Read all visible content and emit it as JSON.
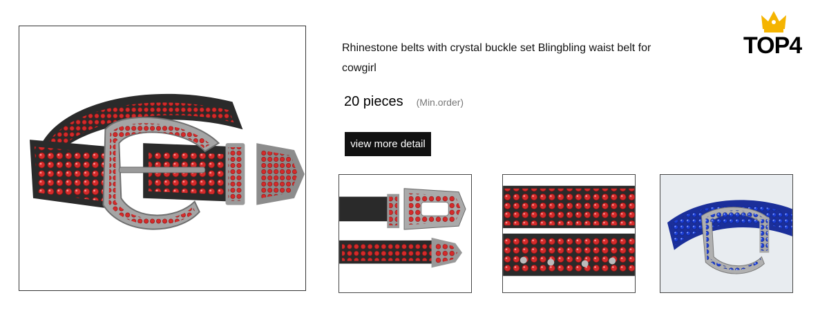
{
  "product": {
    "title": "Rhinestone belts with crystal buckle set Blingbling waist belt for cowgirl",
    "quantity": "20 pieces",
    "quantity_note": "(Min.order)",
    "detail_button_label": "view more detail"
  },
  "brand": {
    "logo_text": "TOP4",
    "crown_icon": "crown-icon",
    "crown_color": "#f5b400"
  },
  "images": {
    "main": {
      "subject": "red-rhinestone-belt",
      "stone_color": "#d42a2a"
    },
    "thumbnails": [
      {
        "subject": "buckle-closeup",
        "stone_color": "#d42a2a"
      },
      {
        "subject": "strap-closeup",
        "stone_color": "#d42a2a"
      },
      {
        "subject": "blue-rhinestone-belt",
        "stone_color": "#1d3fd6"
      }
    ]
  }
}
